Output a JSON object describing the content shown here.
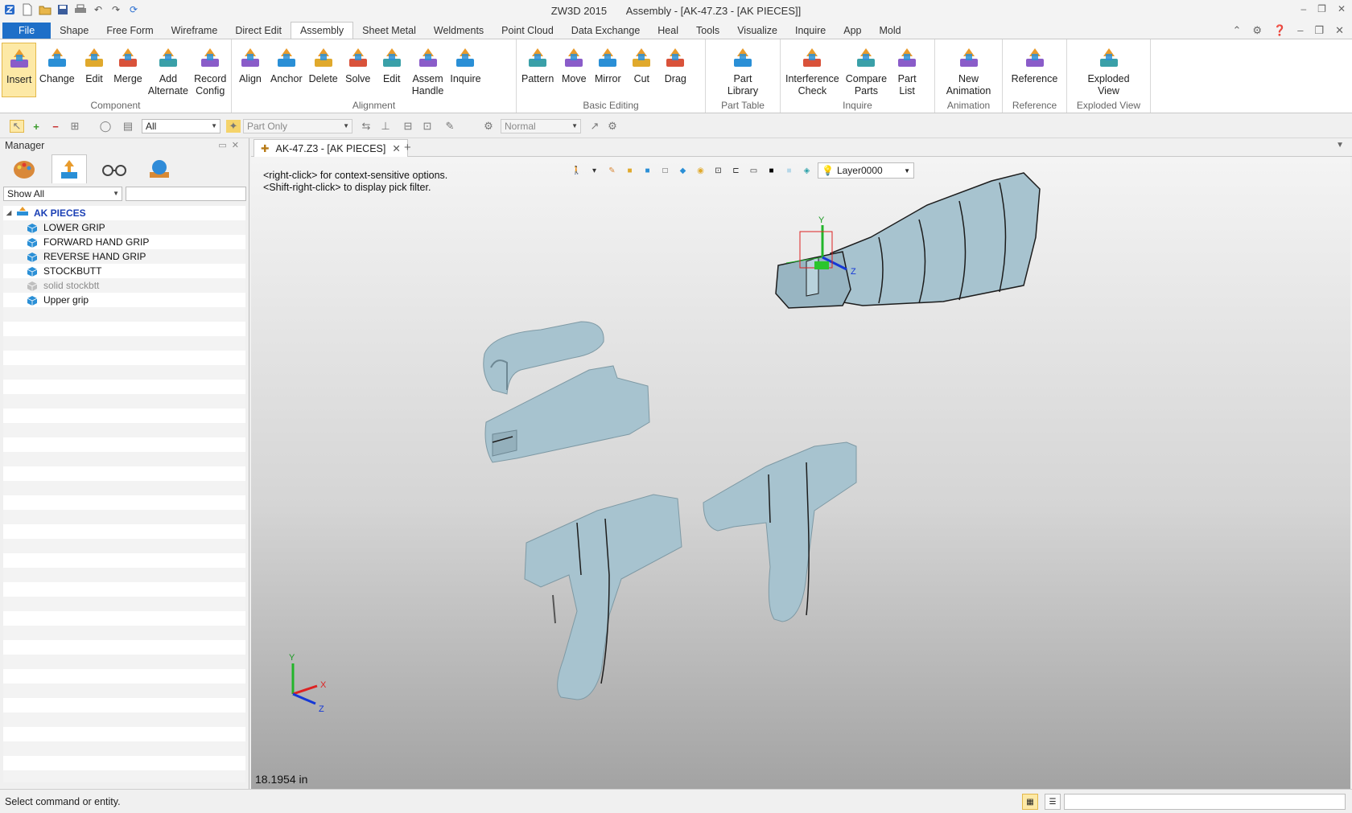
{
  "window": {
    "app_name": "ZW3D 2015",
    "title": "Assembly - [AK-47.Z3 - [AK PIECES]]"
  },
  "menu_tabs": [
    "File",
    "Shape",
    "Free Form",
    "Wireframe",
    "Direct Edit",
    "Assembly",
    "Sheet Metal",
    "Weldments",
    "Point Cloud",
    "Data Exchange",
    "Heal",
    "Tools",
    "Visualize",
    "Inquire",
    "App",
    "Mold"
  ],
  "active_tab": "Assembly",
  "ribbon": {
    "component": {
      "label": "Component",
      "buttons": [
        "Insert",
        "Change",
        "Edit",
        "Merge",
        "Add\nAlternate",
        "Record\nConfig"
      ]
    },
    "alignment": {
      "label": "Alignment",
      "buttons": [
        "Align",
        "Anchor",
        "Delete",
        "Solve",
        "Edit",
        "Assem\nHandle",
        "Inquire"
      ]
    },
    "basic_editing": {
      "label": "Basic Editing",
      "buttons": [
        "Pattern",
        "Move",
        "Mirror",
        "Cut",
        "Drag"
      ]
    },
    "part_table": {
      "label": "Part Table",
      "buttons": [
        "Part\nLibrary"
      ]
    },
    "inquire": {
      "label": "Inquire",
      "buttons": [
        "Interference\nCheck",
        "Compare\nParts",
        "Part\nList"
      ]
    },
    "animation": {
      "label": "Animation",
      "buttons": [
        "New\nAnimation"
      ]
    },
    "reference": {
      "label": "Reference",
      "buttons": [
        "Reference"
      ]
    },
    "exploded_view": {
      "label": "Exploded View",
      "buttons": [
        "Exploded\nView"
      ]
    }
  },
  "subtoolbar": {
    "filter": "All",
    "scope": "Part Only",
    "mode": "Normal"
  },
  "manager": {
    "title": "Manager",
    "filter": "Show All",
    "root": "AK PIECES",
    "items": [
      {
        "label": "LOWER GRIP",
        "muted": false
      },
      {
        "label": "FORWARD HAND GRIP",
        "muted": false
      },
      {
        "label": "REVERSE HAND GRIP",
        "muted": false
      },
      {
        "label": "STOCKBUTT",
        "muted": false
      },
      {
        "label": "solid stockbtt",
        "muted": true
      },
      {
        "label": "Upper grip",
        "muted": false
      }
    ]
  },
  "document_tab": "AK-47.Z3 - [AK PIECES]",
  "viewport": {
    "hint1": "<right-click> for context-sensitive options.",
    "hint2": "<Shift-right-click> to display pick filter.",
    "measurement": "18.1954 in",
    "layer": "Layer0000",
    "triad": {
      "x": "X",
      "y": "Y",
      "z": "Z"
    }
  },
  "status": {
    "message": "Select command or entity."
  },
  "colors": {
    "file_tab": "#1e6fc8",
    "part_fill": "#a7c3cf",
    "part_edge": "#1c1c1c",
    "tree_root": "#1a3fb5"
  }
}
